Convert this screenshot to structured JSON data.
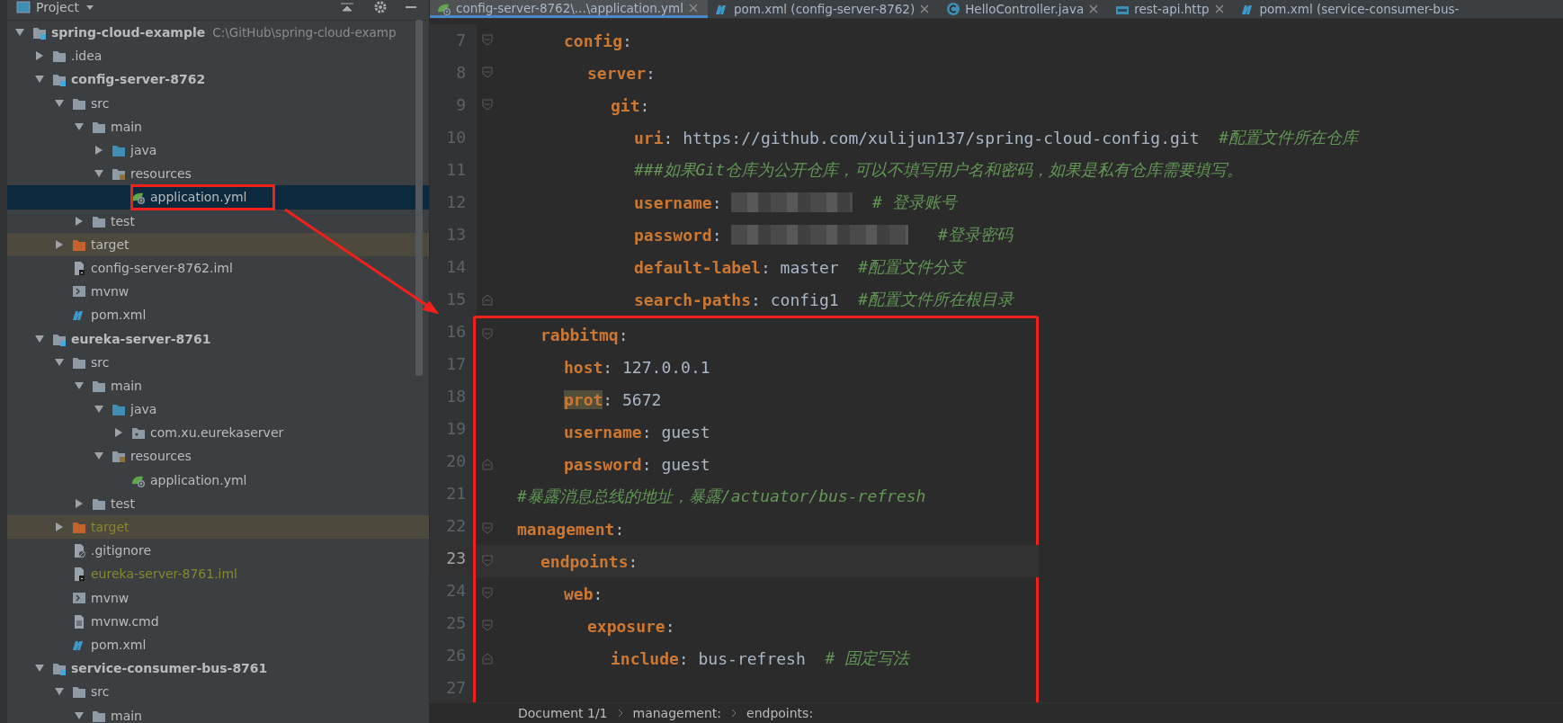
{
  "project_panel": {
    "title": "Project",
    "tree": [
      {
        "label": "spring-cloud-example",
        "path": "C:\\GitHub\\spring-cloud-examp",
        "kind": "module",
        "expanded": true,
        "selected": false,
        "children": [
          {
            "label": ".idea",
            "kind": "folder",
            "expanded": false,
            "selected": false
          },
          {
            "label": "config-server-8762",
            "kind": "module",
            "expanded": true,
            "selected": false,
            "children": [
              {
                "label": "src",
                "kind": "folder",
                "expanded": true,
                "selected": false,
                "children": [
                  {
                    "label": "main",
                    "kind": "folder",
                    "expanded": true,
                    "selected": false,
                    "children": [
                      {
                        "label": "java",
                        "kind": "source-folder",
                        "expanded": false,
                        "selected": false
                      },
                      {
                        "label": "resources",
                        "kind": "resource-folder",
                        "expanded": true,
                        "selected": false,
                        "children": [
                          {
                            "label": "application.yml",
                            "kind": "spring-file",
                            "selected": true,
                            "boxed": true
                          }
                        ]
                      }
                    ]
                  },
                  {
                    "label": "test",
                    "kind": "folder",
                    "expanded": false,
                    "selected": false
                  }
                ]
              },
              {
                "label": "target",
                "kind": "excluded-folder",
                "expanded": false,
                "selected": false
              },
              {
                "label": "config-server-8762.iml",
                "kind": "iml",
                "selected": false
              },
              {
                "label": "mvnw",
                "kind": "script",
                "selected": false
              },
              {
                "label": "pom.xml",
                "kind": "maven",
                "selected": false
              }
            ]
          },
          {
            "label": "eureka-server-8761",
            "kind": "module",
            "expanded": true,
            "selected": false,
            "children": [
              {
                "label": "src",
                "kind": "folder",
                "expanded": true,
                "selected": false,
                "children": [
                  {
                    "label": "main",
                    "kind": "folder",
                    "expanded": true,
                    "selected": false,
                    "children": [
                      {
                        "label": "java",
                        "kind": "source-folder",
                        "expanded": true,
                        "selected": false,
                        "children": [
                          {
                            "label": "com.xu.eurekaserver",
                            "kind": "package",
                            "expanded": false,
                            "selected": false
                          }
                        ]
                      },
                      {
                        "label": "resources",
                        "kind": "resource-folder",
                        "expanded": true,
                        "selected": false,
                        "children": [
                          {
                            "label": "application.yml",
                            "kind": "spring-file",
                            "selected": false
                          }
                        ]
                      }
                    ]
                  },
                  {
                    "label": "test",
                    "kind": "folder",
                    "expanded": false,
                    "selected": false
                  }
                ]
              },
              {
                "label": "target",
                "kind": "excluded-folder",
                "expanded": false,
                "selected": false,
                "ignored": true
              },
              {
                "label": ".gitignore",
                "kind": "gitignore",
                "selected": false
              },
              {
                "label": "eureka-server-8761.iml",
                "kind": "iml",
                "selected": false,
                "ignored": true
              },
              {
                "label": "mvnw",
                "kind": "script",
                "selected": false
              },
              {
                "label": "mvnw.cmd",
                "kind": "text",
                "selected": false
              },
              {
                "label": "pom.xml",
                "kind": "maven",
                "selected": false
              }
            ]
          },
          {
            "label": "service-consumer-bus-8761",
            "kind": "module",
            "expanded": true,
            "selected": false,
            "children": [
              {
                "label": "src",
                "kind": "folder",
                "expanded": true,
                "selected": false,
                "children": [
                  {
                    "label": "main",
                    "kind": "folder",
                    "expanded": true,
                    "selected": false
                  }
                ]
              }
            ]
          }
        ]
      }
    ]
  },
  "tabs": [
    {
      "label": "config-server-8762\\...\\application.yml",
      "kind": "spring",
      "selected": true
    },
    {
      "label": "pom.xml (config-server-8762)",
      "kind": "maven",
      "selected": false
    },
    {
      "label": "HelloController.java",
      "kind": "class",
      "selected": false
    },
    {
      "label": "rest-api.http",
      "kind": "http",
      "selected": false
    },
    {
      "label": "pom.xml (service-consumer-bus-",
      "kind": "maven",
      "selected": false
    }
  ],
  "editor": {
    "lines": [
      {
        "children": [
          {
            "children": [
              {
                "number": "7",
                "fold_start": true,
                "fold_end": false,
                "current": false,
                "boxed": false,
                "segments": [
                  {
                    "kind": "key",
                    "text": "config"
                  },
                  {
                    "kind": "colon",
                    "text": ":"
                  }
                ],
                "children": [
                  {
                    "number": "8",
                    "fold_start": true,
                    "fold_end": false,
                    "current": false,
                    "boxed": false,
                    "segments": [
                      {
                        "kind": "key",
                        "text": "server"
                      },
                      {
                        "kind": "colon",
                        "text": ":"
                      }
                    ],
                    "children": [
                      {
                        "number": "9",
                        "fold_start": true,
                        "fold_end": false,
                        "current": false,
                        "boxed": false,
                        "segments": [
                          {
                            "kind": "key",
                            "text": "git"
                          },
                          {
                            "kind": "colon",
                            "text": ":"
                          }
                        ],
                        "children": [
                          {
                            "number": "10",
                            "fold_start": false,
                            "fold_end": false,
                            "current": false,
                            "boxed": false,
                            "segments": [
                              {
                                "kind": "key",
                                "text": "uri"
                              },
                              {
                                "kind": "colon",
                                "text": ":"
                              },
                              {
                                "kind": "value",
                                "text": "https://github.com/xulijun137/spring-cloud-config.git"
                              },
                              {
                                "kind": "comment",
                                "text": "#配置文件所在仓库"
                              }
                            ]
                          },
                          {
                            "number": "11",
                            "fold_start": false,
                            "fold_end": false,
                            "current": false,
                            "boxed": false,
                            "segments": [
                              {
                                "kind": "comment",
                                "text": "###如果Git仓库为公开仓库，可以不填写用户名和密码，如果是私有仓库需要填写。"
                              }
                            ]
                          },
                          {
                            "number": "12",
                            "fold_start": false,
                            "fold_end": false,
                            "current": false,
                            "boxed": false,
                            "segments": [
                              {
                                "kind": "key",
                                "text": "username"
                              },
                              {
                                "kind": "colon",
                                "text": ":"
                              },
                              {
                                "kind": "redacted-short"
                              },
                              {
                                "kind": "comment",
                                "text": "# 登录账号"
                              }
                            ]
                          },
                          {
                            "number": "13",
                            "fold_start": false,
                            "fold_end": false,
                            "current": false,
                            "boxed": false,
                            "segments": [
                              {
                                "kind": "key",
                                "text": "password"
                              },
                              {
                                "kind": "colon",
                                "text": ":"
                              },
                              {
                                "kind": "redacted-long"
                              },
                              {
                                "kind": "comment",
                                "text": "#登录密码"
                              }
                            ]
                          },
                          {
                            "number": "14",
                            "fold_start": false,
                            "fold_end": false,
                            "current": false,
                            "boxed": false,
                            "segments": [
                              {
                                "kind": "key",
                                "text": "default-label"
                              },
                              {
                                "kind": "colon",
                                "text": ":"
                              },
                              {
                                "kind": "value",
                                "text": "master"
                              },
                              {
                                "kind": "comment",
                                "text": "#配置文件分支"
                              }
                            ]
                          },
                          {
                            "number": "15",
                            "fold_start": false,
                            "fold_end": true,
                            "current": false,
                            "boxed": false,
                            "segments": [
                              {
                                "kind": "key",
                                "text": "search-paths"
                              },
                              {
                                "kind": "colon",
                                "text": ":"
                              },
                              {
                                "kind": "value",
                                "text": "config1"
                              },
                              {
                                "kind": "comment",
                                "text": "#配置文件所在根目录"
                              }
                            ]
                          }
                        ]
                      }
                    ]
                  }
                ]
              }
            ]
          },
          {
            "number": "16",
            "fold_start": true,
            "fold_end": false,
            "current": false,
            "boxed": true,
            "segments": [
              {
                "kind": "key",
                "text": "rabbitmq"
              },
              {
                "kind": "colon",
                "text": ":"
              }
            ],
            "children": [
              {
                "number": "17",
                "fold_start": false,
                "fold_end": false,
                "current": false,
                "boxed": true,
                "segments": [
                  {
                    "kind": "key",
                    "text": "host"
                  },
                  {
                    "kind": "colon",
                    "text": ":"
                  },
                  {
                    "kind": "value",
                    "text": "127.0.0.1"
                  }
                ]
              },
              {
                "number": "18",
                "fold_start": false,
                "fold_end": false,
                "current": false,
                "boxed": true,
                "segments": [
                  {
                    "kind": "warn-key",
                    "text": "prot"
                  },
                  {
                    "kind": "colon",
                    "text": ":"
                  },
                  {
                    "kind": "value",
                    "text": "5672"
                  }
                ]
              },
              {
                "number": "19",
                "fold_start": false,
                "fold_end": false,
                "current": false,
                "boxed": true,
                "segments": [
                  {
                    "kind": "key",
                    "text": "username"
                  },
                  {
                    "kind": "colon",
                    "text": ":"
                  },
                  {
                    "kind": "value",
                    "text": "guest"
                  }
                ]
              },
              {
                "number": "20",
                "fold_start": false,
                "fold_end": true,
                "current": false,
                "boxed": true,
                "segments": [
                  {
                    "kind": "key",
                    "text": "password"
                  },
                  {
                    "kind": "colon",
                    "text": ":"
                  },
                  {
                    "kind": "value",
                    "text": "guest"
                  }
                ]
              }
            ]
          }
        ]
      },
      {
        "number": "21",
        "fold_start": false,
        "fold_end": false,
        "current": false,
        "boxed": true,
        "segments": [
          {
            "kind": "comment",
            "text": "#暴露消息总线的地址，暴露/actuator/bus-refresh"
          }
        ]
      },
      {
        "number": "22",
        "fold_start": true,
        "fold_end": false,
        "current": false,
        "boxed": true,
        "segments": [
          {
            "kind": "key",
            "text": "management"
          },
          {
            "kind": "colon",
            "text": ":"
          }
        ],
        "children": [
          {
            "number": "23",
            "fold_start": true,
            "fold_end": false,
            "current": true,
            "boxed": true,
            "segments": [
              {
                "kind": "key",
                "text": "endpoints"
              },
              {
                "kind": "colon",
                "text": ":"
              }
            ],
            "children": [
              {
                "number": "24",
                "fold_start": true,
                "fold_end": false,
                "current": false,
                "boxed": true,
                "segments": [
                  {
                    "kind": "key",
                    "text": "web"
                  },
                  {
                    "kind": "colon",
                    "text": ":"
                  }
                ],
                "children": [
                  {
                    "number": "25",
                    "fold_start": true,
                    "fold_end": false,
                    "current": false,
                    "boxed": true,
                    "segments": [
                      {
                        "kind": "key",
                        "text": "exposure"
                      },
                      {
                        "kind": "colon",
                        "text": ":"
                      }
                    ],
                    "children": [
                      {
                        "number": "26",
                        "fold_start": false,
                        "fold_end": true,
                        "current": false,
                        "boxed": true,
                        "segments": [
                          {
                            "kind": "key",
                            "text": "include"
                          },
                          {
                            "kind": "colon",
                            "text": ":"
                          },
                          {
                            "kind": "value",
                            "text": "bus-refresh"
                          },
                          {
                            "kind": "comment",
                            "text": "# 固定写法"
                          }
                        ]
                      }
                    ]
                  }
                ]
              }
            ]
          }
        ]
      },
      {
        "number": "27",
        "fold_start": false,
        "fold_end": false,
        "current": false,
        "boxed": true
      }
    ]
  },
  "breadcrumbs": [
    "Document 1/1",
    "management:",
    "endpoints:"
  ],
  "annotations": [
    {
      "kind": "arrow"
    }
  ]
}
